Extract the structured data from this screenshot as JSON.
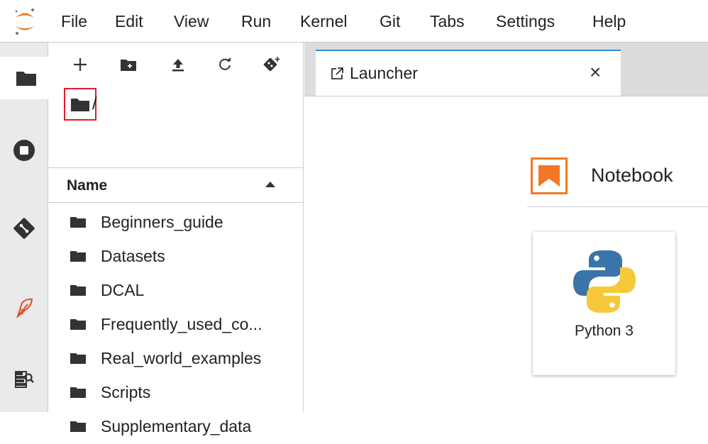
{
  "menu": {
    "items": [
      "File",
      "Edit",
      "View",
      "Run",
      "Kernel",
      "Git",
      "Tabs",
      "Settings",
      "Help"
    ]
  },
  "activity_bar": {
    "icons": [
      "folder-icon",
      "running-icon",
      "git-icon",
      "extension-icon",
      "property-inspector-icon"
    ]
  },
  "file_browser": {
    "breadcrumb_separator": "/",
    "column_header": "Name",
    "items": [
      {
        "name": "Beginners_guide",
        "type": "folder"
      },
      {
        "name": "Datasets",
        "type": "folder"
      },
      {
        "name": "DCAL",
        "type": "folder"
      },
      {
        "name": "Frequently_used_co...",
        "type": "folder"
      },
      {
        "name": "Real_world_examples",
        "type": "folder"
      },
      {
        "name": "Scripts",
        "type": "folder"
      },
      {
        "name": "Supplementary_data",
        "type": "folder"
      }
    ]
  },
  "tabs": [
    {
      "label": "Launcher",
      "close": "×"
    }
  ],
  "launcher": {
    "section_title": "Notebook",
    "kernel_label": "Python 3"
  },
  "colors": {
    "accent_orange": "#f37726",
    "tab_active_border": "#2e8bd6",
    "highlight_red": "#e0192c"
  }
}
